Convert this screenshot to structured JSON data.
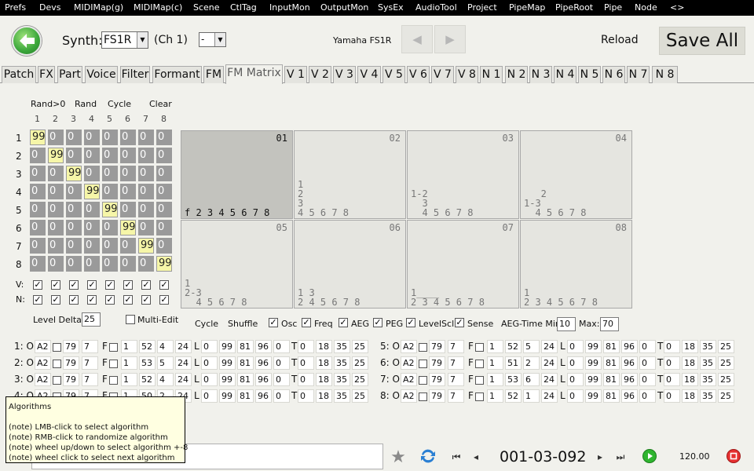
{
  "menu": [
    "Prefs",
    "Devs",
    "MIDIMap(g)",
    "MIDIMap(c)",
    "Scene",
    "CtlTag",
    "InputMon",
    "OutputMon",
    "SysEx",
    "AudioTool",
    "Project",
    "PipeMap",
    "PipeRoot",
    "Pipe",
    "Node",
    "<>"
  ],
  "top": {
    "synth_label": "Synth:",
    "synth_value": "FS1R",
    "channel": "(Ch 1)",
    "part_value": "-",
    "device_name": "Yamaha FS1R",
    "reload": "Reload",
    "save_all": "Save All"
  },
  "tabs": [
    "Patch",
    "FX",
    "Part",
    "Voice",
    "Filter",
    "Formant",
    "FM",
    "FM Matrix",
    "V 1",
    "V 2",
    "V 3",
    "V 4",
    "V 5",
    "V 6",
    "V 7",
    "V 8",
    "N 1",
    "N 2",
    "N 3",
    "N 4",
    "N 5",
    "N 6",
    "N 7",
    "N 8"
  ],
  "active_tab": "FM Matrix",
  "matrix": {
    "actions": [
      "Rand>0",
      "Rand",
      "Cycle",
      "Clear"
    ],
    "col_headers": [
      "1",
      "2",
      "3",
      "4",
      "5",
      "6",
      "7",
      "8"
    ],
    "row_headers": [
      "1",
      "2",
      "3",
      "4",
      "5",
      "6",
      "7",
      "8"
    ],
    "rows": [
      [
        "99",
        "0",
        "0",
        "0",
        "0",
        "0",
        "0",
        "0"
      ],
      [
        "0",
        "99",
        "0",
        "0",
        "0",
        "0",
        "0",
        "0"
      ],
      [
        "0",
        "0",
        "99",
        "0",
        "0",
        "0",
        "0",
        "0"
      ],
      [
        "0",
        "0",
        "0",
        "99",
        "0",
        "0",
        "0",
        "0"
      ],
      [
        "0",
        "0",
        "0",
        "0",
        "99",
        "0",
        "0",
        "0"
      ],
      [
        "0",
        "0",
        "0",
        "0",
        "0",
        "99",
        "0",
        "0"
      ],
      [
        "0",
        "0",
        "0",
        "0",
        "0",
        "0",
        "99",
        "0"
      ],
      [
        "0",
        "0",
        "0",
        "0",
        "0",
        "0",
        "0",
        "99"
      ]
    ],
    "v_label": "V:",
    "n_label": "N:"
  },
  "algorithms": [
    {
      "num": "01",
      "lines": [
        "f 2 3 4 5 6 7 8"
      ]
    },
    {
      "num": "02",
      "lines": [
        "1",
        "2",
        "3",
        "4 5 6 7 8"
      ]
    },
    {
      "num": "03",
      "lines": [
        "1-2",
        "  3",
        "  4 5 6 7 8"
      ]
    },
    {
      "num": "04",
      "lines": [
        "   2",
        "1-3",
        "  4 5 6 7 8"
      ]
    },
    {
      "num": "05",
      "lines": [
        "1",
        "2-3",
        "  4 5 6 7 8"
      ]
    },
    {
      "num": "06",
      "lines": [
        "1 3",
        "2 4 5 6 7 8"
      ]
    },
    {
      "num": "07",
      "lines": [
        "1____",
        "2 3 4 5 6 7 8"
      ]
    },
    {
      "num": "08",
      "lines": [
        "1",
        "2 3 4 5 6 7 8"
      ]
    }
  ],
  "options": {
    "level_delta_label": "Level Delta:",
    "level_delta": "25",
    "multi_edit": "Multi-Edit",
    "cycle": "Cycle",
    "shuffle": "Shuffle",
    "checks": [
      "Osc",
      "Freq",
      "AEG",
      "PEG",
      "LevelScl",
      "Sense"
    ],
    "aeg_time_min_label": "AEG-Time Min:",
    "aeg_time_min": "10",
    "max_label": "Max:",
    "max": "70"
  },
  "operators": [
    {
      "label": "1: O",
      "wave": "A2",
      "v1": "79",
      "v2": "7",
      "f1": "1",
      "f2": "52",
      "f3": "4",
      "f4": "24",
      "l1": "0",
      "l2": "99",
      "l3": "81",
      "l4": "96",
      "l5": "0",
      "t1": "0",
      "t2": "18",
      "t3": "35",
      "t4": "25"
    },
    {
      "label": "2: O",
      "wave": "A2",
      "v1": "79",
      "v2": "7",
      "f1": "1",
      "f2": "53",
      "f3": "5",
      "f4": "24",
      "l1": "0",
      "l2": "99",
      "l3": "81",
      "l4": "96",
      "l5": "0",
      "t1": "0",
      "t2": "18",
      "t3": "35",
      "t4": "25"
    },
    {
      "label": "3: O",
      "wave": "A2",
      "v1": "79",
      "v2": "7",
      "f1": "1",
      "f2": "52",
      "f3": "4",
      "f4": "24",
      "l1": "0",
      "l2": "99",
      "l3": "81",
      "l4": "96",
      "l5": "0",
      "t1": "0",
      "t2": "18",
      "t3": "35",
      "t4": "25"
    },
    {
      "label": "4: O",
      "wave": "A2",
      "v1": "79",
      "v2": "7",
      "f1": "1",
      "f2": "50",
      "f3": "2",
      "f4": "24",
      "l1": "0",
      "l2": "99",
      "l3": "81",
      "l4": "96",
      "l5": "0",
      "t1": "0",
      "t2": "18",
      "t3": "35",
      "t4": "25"
    },
    {
      "label": "5: O",
      "wave": "A2",
      "v1": "79",
      "v2": "7",
      "f1": "1",
      "f2": "52",
      "f3": "5",
      "f4": "24",
      "l1": "0",
      "l2": "99",
      "l3": "81",
      "l4": "96",
      "l5": "0",
      "t1": "0",
      "t2": "18",
      "t3": "35",
      "t4": "25"
    },
    {
      "label": "6: O",
      "wave": "A2",
      "v1": "79",
      "v2": "7",
      "f1": "1",
      "f2": "51",
      "f3": "2",
      "f4": "24",
      "l1": "0",
      "l2": "99",
      "l3": "81",
      "l4": "96",
      "l5": "0",
      "t1": "0",
      "t2": "18",
      "t3": "35",
      "t4": "25"
    },
    {
      "label": "7: O",
      "wave": "A2",
      "v1": "79",
      "v2": "7",
      "f1": "1",
      "f2": "53",
      "f3": "6",
      "f4": "24",
      "l1": "0",
      "l2": "99",
      "l3": "81",
      "l4": "96",
      "l5": "0",
      "t1": "0",
      "t2": "18",
      "t3": "35",
      "t4": "25"
    },
    {
      "label": "8: O",
      "wave": "A2",
      "v1": "79",
      "v2": "7",
      "f1": "1",
      "f2": "52",
      "f3": "1",
      "f4": "24",
      "l1": "0",
      "l2": "99",
      "l3": "81",
      "l4": "96",
      "l5": "0",
      "t1": "0",
      "t2": "18",
      "t3": "35",
      "t4": "25"
    }
  ],
  "op_letters": {
    "f": "F",
    "l": "L",
    "t": "T"
  },
  "tooltip": {
    "title": "Algorithms",
    "lines": [
      "(note) LMB-click to select algorithm",
      "(note) RMB-click to randomize algorithm",
      "(note) wheel up/down to select algorithm +-8",
      "(note) wheel click to select next algorithm"
    ]
  },
  "bottom": {
    "position": "001-03-092",
    "tempo": "120.00",
    "icons": [
      "star-icon",
      "sync-icon",
      "skip-start-icon",
      "prev-icon",
      "next-icon",
      "skip-end-icon",
      "play-icon",
      "stop-icon"
    ]
  },
  "colors": {
    "matrix_cell": "#9a9a9a",
    "matrix_diag": "#f6f6a8",
    "selected_algo": "#c3c3be",
    "menubar": "#000000"
  }
}
